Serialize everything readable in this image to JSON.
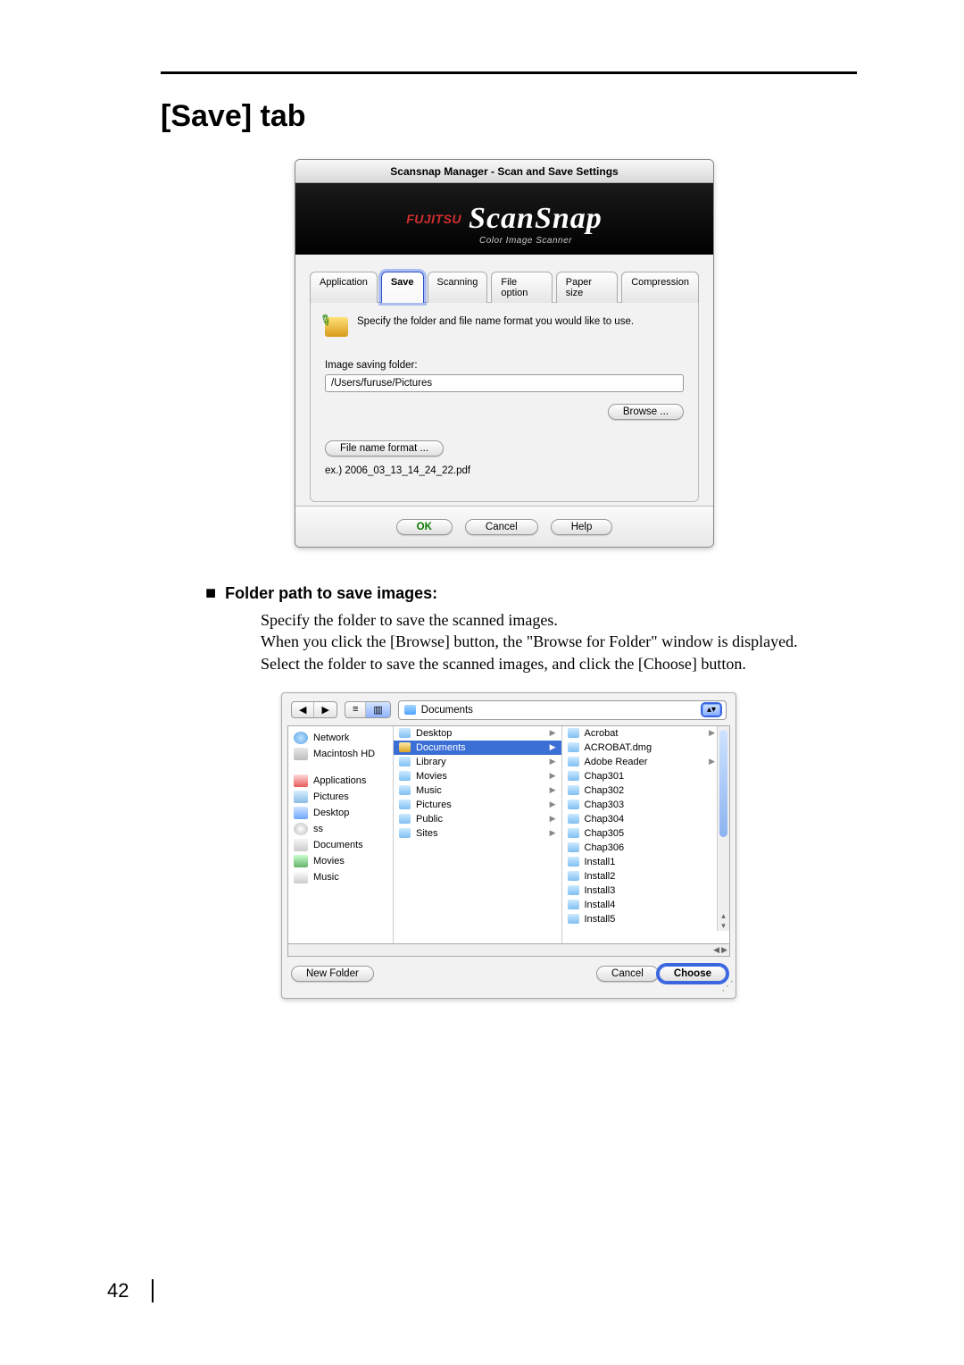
{
  "heading": "[Save] tab",
  "dialog": {
    "title": "Scansnap Manager - Scan and Save Settings",
    "banner_brand": "FUJITSU",
    "banner_name": "ScanSnap",
    "banner_subtitle": "Color Image Scanner",
    "tabs": [
      "Application",
      "Save",
      "Scanning",
      "File option",
      "Paper size",
      "Compression"
    ],
    "tab_instruction": "Specify the folder and file name format you would like to use.",
    "folder_label": "Image saving folder:",
    "folder_path": "/Users/furuse/Pictures",
    "browse_btn": "Browse ...",
    "fnf_btn": "File name format ...",
    "example": "ex.) 2006_03_13_14_24_22.pdf",
    "ok": "OK",
    "cancel": "Cancel",
    "help": "Help"
  },
  "section": {
    "title": "Folder path to save images:",
    "p1": "Specify the folder to save the scanned images.",
    "p2": "When you click the [Browse] button, the \"Browse for Folder\" window is displayed.",
    "p3": "Select the folder to save the scanned images, and click the [Choose] button."
  },
  "browser": {
    "path_label": "Documents",
    "sidebar": [
      "Network",
      "Macintosh HD",
      "",
      "Applications",
      "Pictures",
      "Desktop",
      "ss",
      "Documents",
      "Movies",
      "Music"
    ],
    "col1": [
      {
        "name": "Desktop",
        "tri": true
      },
      {
        "name": "Documents",
        "tri": true,
        "sel": true
      },
      {
        "name": "Library",
        "tri": true
      },
      {
        "name": "Movies",
        "tri": true
      },
      {
        "name": "Music",
        "tri": true
      },
      {
        "name": "Pictures",
        "tri": true
      },
      {
        "name": "Public",
        "tri": true
      },
      {
        "name": "Sites",
        "tri": true
      }
    ],
    "col2": [
      {
        "name": "Acrobat",
        "tri": true
      },
      {
        "name": "ACROBAT.dmg"
      },
      {
        "name": "Adobe Reader",
        "tri": true
      },
      {
        "name": "Chap301"
      },
      {
        "name": "Chap302"
      },
      {
        "name": "Chap303"
      },
      {
        "name": "Chap304"
      },
      {
        "name": "Chap305"
      },
      {
        "name": "Chap306"
      },
      {
        "name": "Install1"
      },
      {
        "name": "Install2"
      },
      {
        "name": "Install3"
      },
      {
        "name": "Install4"
      },
      {
        "name": "Install5"
      }
    ],
    "new_folder": "New Folder",
    "cancel": "Cancel",
    "choose": "Choose"
  },
  "page_number": "42"
}
